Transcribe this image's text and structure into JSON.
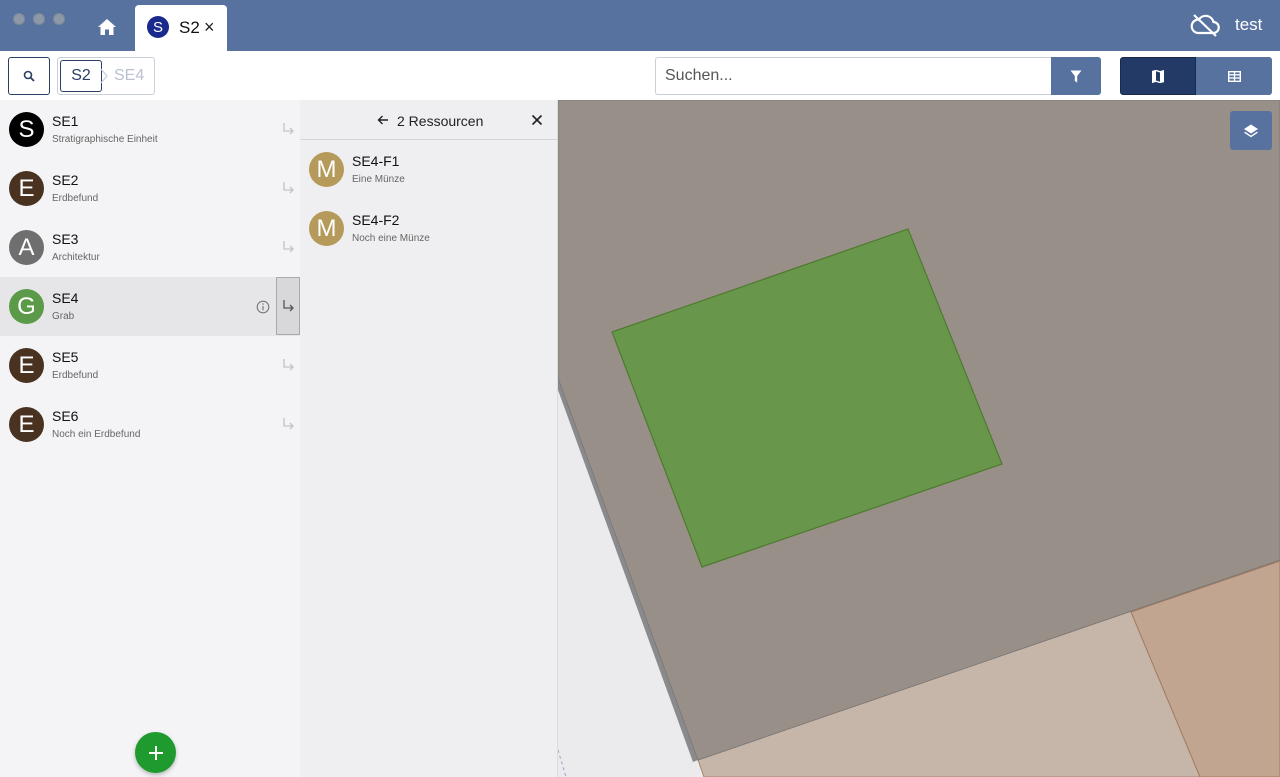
{
  "titlebar": {
    "home_icon": "home-icon",
    "tab": {
      "avatar_letter": "S",
      "label": "S2",
      "close": "×"
    },
    "cloud_icon": "cloud-off-icon",
    "user": "test"
  },
  "toolbar": {
    "breadcrumb": [
      "S2",
      "SE4"
    ],
    "search_placeholder": "Suchen...",
    "filter_icon": "filter-icon",
    "map_view_icon": "map-icon",
    "table_view_icon": "table-icon"
  },
  "list": {
    "items": [
      {
        "letter": "S",
        "id": "SE1",
        "type": "Stratigraphische Einheit",
        "color": "#000000"
      },
      {
        "letter": "E",
        "id": "SE2",
        "type": "Erdbefund",
        "color": "#4a3220"
      },
      {
        "letter": "A",
        "id": "SE3",
        "type": "Architektur",
        "color": "#6f6f6f"
      },
      {
        "letter": "G",
        "id": "SE4",
        "type": "Grab",
        "color": "#5a9a48"
      },
      {
        "letter": "E",
        "id": "SE5",
        "type": "Erdbefund",
        "color": "#4a3220"
      },
      {
        "letter": "E",
        "id": "SE6",
        "type": "Noch ein Erdbefund",
        "color": "#4a3220"
      }
    ]
  },
  "children_panel": {
    "title": "2 Ressourcen",
    "items": [
      {
        "letter": "M",
        "id": "SE4-F1",
        "sub": "Eine Münze"
      },
      {
        "letter": "M",
        "id": "SE4-F2",
        "sub": "Noch eine Münze"
      }
    ]
  },
  "map": {
    "layers_icon": "layers-icon",
    "colors": {
      "grey_feature": "#998f89",
      "grave": "#68964a",
      "tan_feature": "#c6b5a9",
      "brown_feature": "#c2a591",
      "background": "#ebebed"
    }
  },
  "accent_colors": {
    "header": "#5872a0",
    "dark_nav": "#243a66",
    "add_button": "#1f9a2e"
  }
}
